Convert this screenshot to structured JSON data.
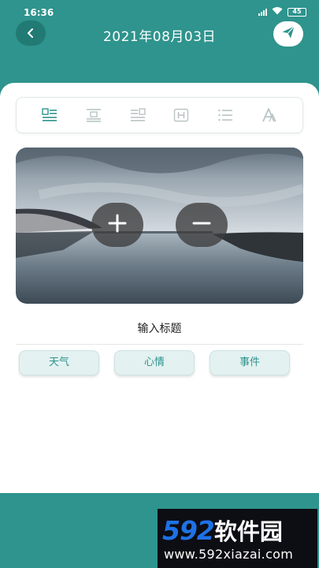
{
  "status": {
    "time": "16:36",
    "battery": "45"
  },
  "header": {
    "title": "2021年08月03日"
  },
  "toolbar": {
    "tools": [
      "align-left-icon",
      "align-center-icon",
      "align-right-icon",
      "heading-icon",
      "list-icon",
      "font-icon"
    ],
    "accent": "#2e948d",
    "inactive_color": "#b9c4c4"
  },
  "editor": {
    "title_placeholder": "输入标题"
  },
  "tags": {
    "weather": "天气",
    "mood": "心情",
    "event": "事件"
  },
  "watermark": {
    "logo_num": "592",
    "logo_cn": "软件园",
    "url": "www.592xiazai.com"
  },
  "colors": {
    "primary": "#2e948d",
    "primary_dark": "#227a74",
    "card": "#ffffff"
  }
}
